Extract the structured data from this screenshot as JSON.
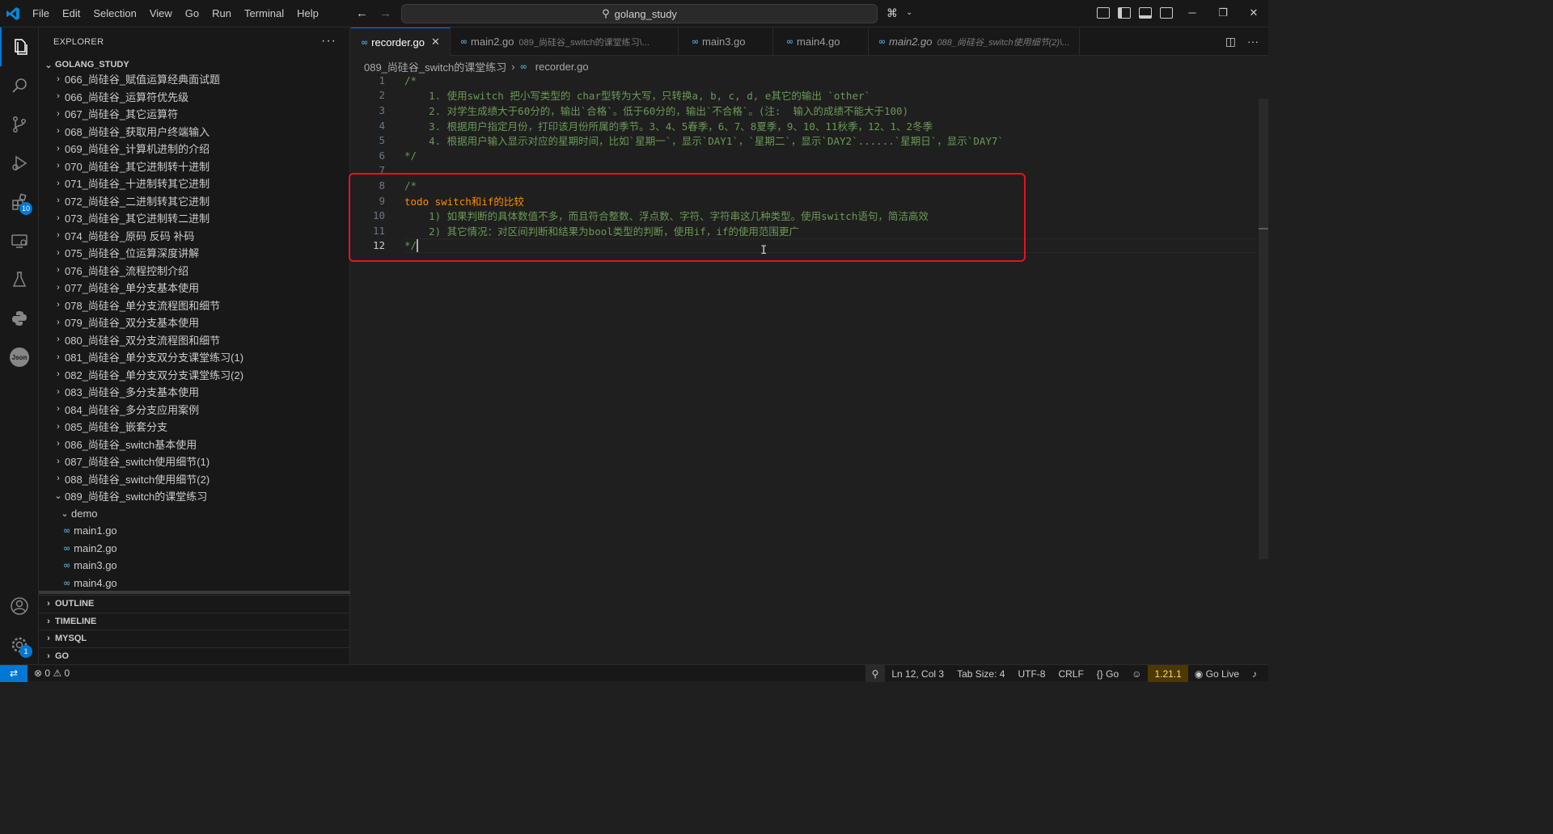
{
  "titlebar": {
    "menu": [
      "File",
      "Edit",
      "Selection",
      "View",
      "Go",
      "Run",
      "Terminal",
      "Help"
    ],
    "search_text": "golang_study"
  },
  "activitybar": {
    "extensions_badge": "10",
    "settings_badge": "1"
  },
  "sidebar": {
    "header": "EXPLORER",
    "project": "GOLANG_STUDY",
    "folders": [
      "066_尚硅谷_赋值运算经典面试题",
      "066_尚硅谷_运算符优先级",
      "067_尚硅谷_其它运算符",
      "068_尚硅谷_获取用户终端输入",
      "069_尚硅谷_计算机进制的介绍",
      "070_尚硅谷_其它进制转十进制",
      "071_尚硅谷_十进制转其它进制",
      "072_尚硅谷_二进制转其它进制",
      "073_尚硅谷_其它进制转二进制",
      "074_尚硅谷_原码 反码 补码",
      "075_尚硅谷_位运算深度讲解",
      "076_尚硅谷_流程控制介绍",
      "077_尚硅谷_单分支基本使用",
      "078_尚硅谷_单分支流程图和细节",
      "079_尚硅谷_双分支基本使用",
      "080_尚硅谷_双分支流程图和细节",
      "081_尚硅谷_单分支双分支课堂练习(1)",
      "082_尚硅谷_单分支双分支课堂练习(2)",
      "083_尚硅谷_多分支基本使用",
      "084_尚硅谷_多分支应用案例",
      "085_尚硅谷_嵌套分支",
      "086_尚硅谷_switch基本使用",
      "087_尚硅谷_switch使用细节(1)",
      "088_尚硅谷_switch使用细节(2)"
    ],
    "open_folder": "089_尚硅谷_switch的课堂练习",
    "sub_folder": "demo",
    "files": [
      "main1.go",
      "main2.go",
      "main3.go",
      "main4.go"
    ],
    "sections": [
      "OUTLINE",
      "TIMELINE",
      "MYSQL",
      "GO"
    ]
  },
  "tabs": [
    {
      "label": "recorder.go",
      "desc": "",
      "active": true
    },
    {
      "label": "main2.go",
      "desc": "089_尚硅谷_switch的课堂练习\\...",
      "active": false
    },
    {
      "label": "main3.go",
      "desc": "",
      "active": false
    },
    {
      "label": "main4.go",
      "desc": "",
      "active": false
    },
    {
      "label": "main2.go",
      "desc": "088_尚硅谷_switch使用细节(2)\\...",
      "active": false
    }
  ],
  "breadcrumb": {
    "folder": "089_尚硅谷_switch的课堂练习",
    "file": "recorder.go"
  },
  "code_lines": [
    {
      "n": "1",
      "text": "/*"
    },
    {
      "n": "2",
      "text": "    1. 使用switch 把小写类型的 char型转为大写，只转换a, b, c, d, e其它的输出 `other`"
    },
    {
      "n": "3",
      "text": "    2. 对学生成绩大于60分的，输出`合格`。低于60分的，输出`不合格`。(注:  输入的成绩不能大于100)"
    },
    {
      "n": "4",
      "text": "    3. 根据用户指定月份，打印该月份所属的季节。3、4、5春季，6、7、8夏季，9、10、11秋季，12、1、2冬季"
    },
    {
      "n": "5",
      "text": "    4. 根据用户输入显示对应的星期时间，比如`星期一`，显示`DAY1`，`星期二`，显示`DAY2`......`星期日`，显示`DAY7`"
    },
    {
      "n": "6",
      "text": "*/"
    },
    {
      "n": "7",
      "text": ""
    },
    {
      "n": "8",
      "text": "/*"
    },
    {
      "n": "9",
      "text": "todo switch和if的比较"
    },
    {
      "n": "10",
      "text": "    1) 如果判断的具体数值不多，而且符合整数、浮点数、字符、字符串这几种类型。使用switch语句，简洁高效"
    },
    {
      "n": "11",
      "text": "    2) 其它情况：对区间判断和结果为bool类型的判断，使用if，if的使用范围更广"
    },
    {
      "n": "12",
      "text": "*/"
    }
  ],
  "statusbar": {
    "errors": "0",
    "warnings": "0",
    "position": "Ln 12, Col 3",
    "tab_size": "Tab Size: 4",
    "encoding": "UTF-8",
    "eol": "CRLF",
    "language": "Go",
    "go_version": "1.21.1",
    "live": "Go Live"
  },
  "colors": {
    "accent": "#0078d4",
    "comment": "#6a9955",
    "todo": "#ff8c00",
    "annotation": "#e81123"
  }
}
